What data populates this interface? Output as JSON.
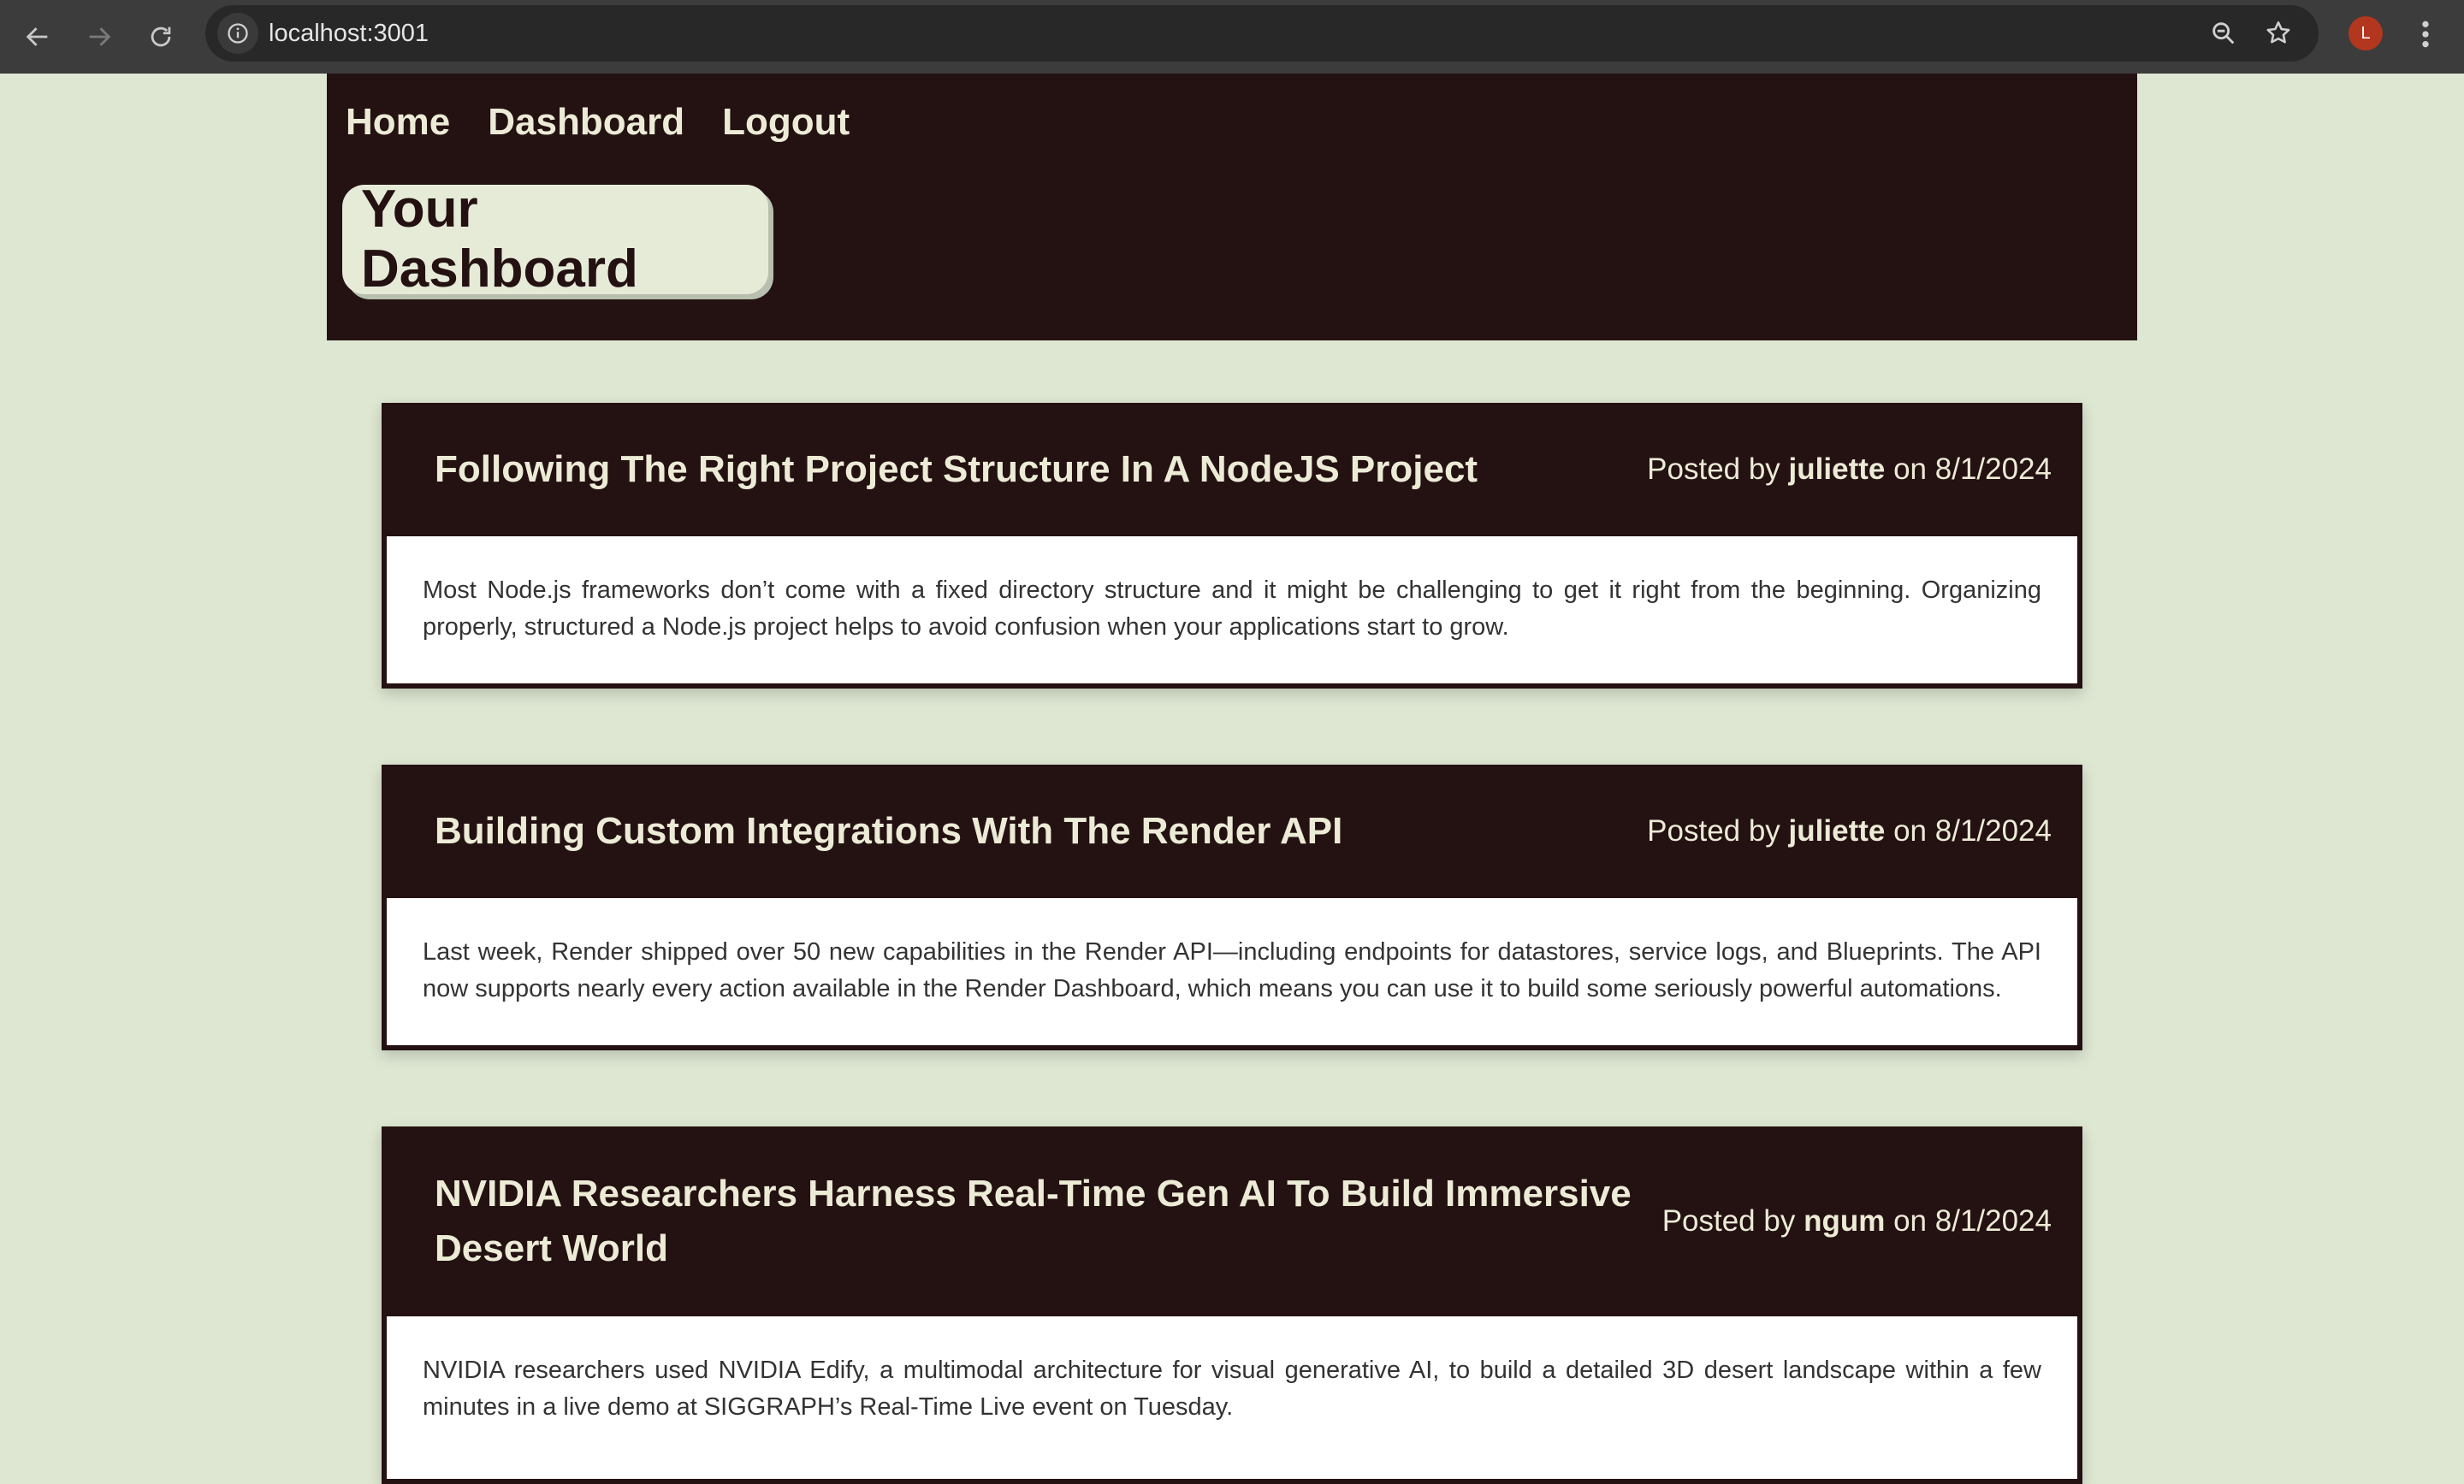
{
  "browser": {
    "url": "localhost:3001",
    "profile_initial": "L",
    "icons": [
      "back-arrow-icon",
      "forward-arrow-icon",
      "reload-icon",
      "site-info-icon",
      "zoom-icon",
      "bookmark-star-icon",
      "kebab-menu-icon"
    ]
  },
  "nav": {
    "home": "Home",
    "dashboard": "Dashboard",
    "logout": "Logout"
  },
  "page_title": "Your Dashboard",
  "posts": [
    {
      "title": "Following The Right Project Structure In A NodeJS Project",
      "posted_by_prefix": "Posted by",
      "author": "juliette",
      "on_word": "on",
      "date": "8/1/2024",
      "body": "Most Node.js frameworks don’t come with a fixed directory structure and it might be challenging to get it right from the beginning. Organizing properly, structured a Node.js project helps to avoid confusion when your applications start to grow."
    },
    {
      "title": "Building Custom Integrations With The Render API",
      "posted_by_prefix": "Posted by",
      "author": "juliette",
      "on_word": "on",
      "date": "8/1/2024",
      "body": "Last week, Render shipped over 50 new capabilities in the Render API—including endpoints for datastores, service logs, and Blueprints. The API now supports nearly every action available in the Render Dashboard, which means you can use it to build some seriously powerful automations."
    },
    {
      "title": "NVIDIA Researchers Harness Real-Time Gen AI To Build Immersive Desert World",
      "posted_by_prefix": "Posted by",
      "author": "ngum",
      "on_word": "on",
      "date": "8/1/2024",
      "body": "NVIDIA researchers used NVIDIA Edify, a multimodal architecture for visual generative AI, to build a detailed 3D desert landscape within a few minutes in a live demo at SIGGRAPH’s Real-Time Live event on Tuesday."
    }
  ],
  "colors": {
    "page_bg": "#dde7d2",
    "header_bg": "#241112",
    "header_text": "#ecebd6",
    "title_box_bg": "#e6ebd8",
    "post_body_bg": "#ffffff",
    "avatar_bg": "#b3361f"
  }
}
